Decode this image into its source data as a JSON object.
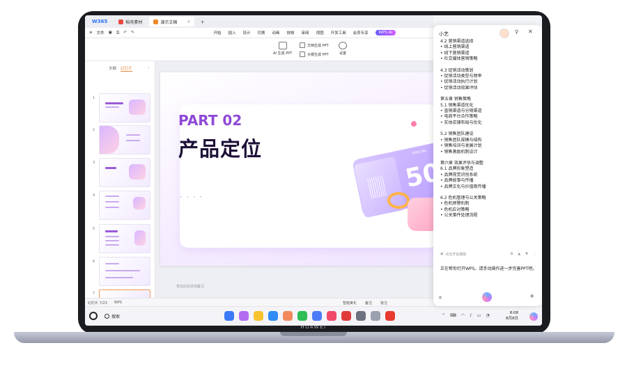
{
  "device": {
    "brand": "HUAWEI"
  },
  "app": {
    "logo": "W365",
    "tabs": [
      {
        "label": "稻壳素材",
        "color": "#e84a3c",
        "active": false
      },
      {
        "label": "演示文稿",
        "color": "#f08a2a",
        "active": true
      }
    ],
    "new_tab": "+",
    "close_glyph": "×"
  },
  "ribbon": {
    "file": "文件",
    "menus": [
      "开始",
      "插入",
      "设计",
      "切换",
      "动画",
      "放映",
      "审阅",
      "视图",
      "开发工具",
      "会员专享"
    ],
    "wps_ai": "WPS AI"
  },
  "toolbar": {
    "ai_generate": "AI 生成 PPT",
    "doc_to_ppt": "文档生成 PPT",
    "outline_to_ppt": "大纲生成 PPT",
    "settings": "设置"
  },
  "left_panel": {
    "tabs": [
      "大纲",
      "幻灯片"
    ],
    "active_tab": "幻灯片",
    "collapse": "‹",
    "slides": [
      "1",
      "2",
      "3",
      "4",
      "5",
      "6",
      "7"
    ],
    "selected_slide": "7",
    "add": "+"
  },
  "slide": {
    "part": "PART 02",
    "title": "产品定位",
    "ticket_number": "50",
    "ticket_caption": "SPECIAL",
    "dots": "• • • •"
  },
  "notes": {
    "placeholder": "单击此处添加备注"
  },
  "status": {
    "slide_counter": "幻灯片 7/23",
    "app_name": "WPS",
    "smart_beautify": "智能美化",
    "notes": "备注",
    "comments": "批注"
  },
  "taskbar": {
    "search": "搜索",
    "apps": [
      {
        "name": "grid-app",
        "color": "#3a79f7"
      },
      {
        "name": "gallery-app",
        "color": "#b36cf0"
      },
      {
        "name": "notes-app",
        "color": "#f6c32f"
      },
      {
        "name": "browser-app",
        "color": "#2f8cf7"
      },
      {
        "name": "photos-app",
        "color": "#f08a5c"
      },
      {
        "name": "messages-app",
        "color": "#2fbf55"
      },
      {
        "name": "music-app",
        "color": "#4b7cf7"
      },
      {
        "name": "calendar-app",
        "color": "#f04a6a"
      },
      {
        "name": "mail-app",
        "color": "#e03a3a"
      },
      {
        "name": "settings-app",
        "color": "#6e7180"
      },
      {
        "name": "trash-app",
        "color": "#9aa0ad"
      },
      {
        "name": "wps-app",
        "color": "#e63b2e"
      }
    ],
    "time": "8:08",
    "date": "8月8日"
  },
  "assistant": {
    "title": "小艺",
    "sections": [
      {
        "heading": "4.2 营销渠道选择",
        "items": [
          "• 线上营销渠道",
          "• 线下营销渠道",
          "• 社交媒体营销策略"
        ]
      },
      {
        "heading": "4.3 促销活动策划",
        "items": [
          "• 促销活动类型与频率",
          "• 促销活动执行计划",
          "• 促销活动效果评估"
        ]
      },
      {
        "heading": "第五章 销售策略",
        "items": [
          "5.1 销售渠道优化",
          "• 直销渠道与分销渠道",
          "• 电商平台合作策略",
          "• 实体店铺布局与优化"
        ]
      },
      {
        "heading": "5.2 销售团队建设",
        "items": [
          "• 销售团队规模与结构",
          "• 销售培训与发展计划",
          "• 销售激励机制设计"
        ]
      },
      {
        "heading": "第六章 效果评估与调整",
        "items": [
          "6.1 品牌形象塑造",
          "• 品牌视觉识别系统",
          "• 品牌故事与传播",
          "• 品牌文化与价值观传播"
        ]
      },
      {
        "heading": "6.2 危机管理与公关策略",
        "items": [
          "• 危机预警机制",
          "• 危机应对策略",
          "• 公关事件处理流程"
        ]
      }
    ],
    "tap_to_play": "点击开始播报",
    "reply": "正在帮你打开WPS。请手动操作进一步完善PPT吧。"
  }
}
